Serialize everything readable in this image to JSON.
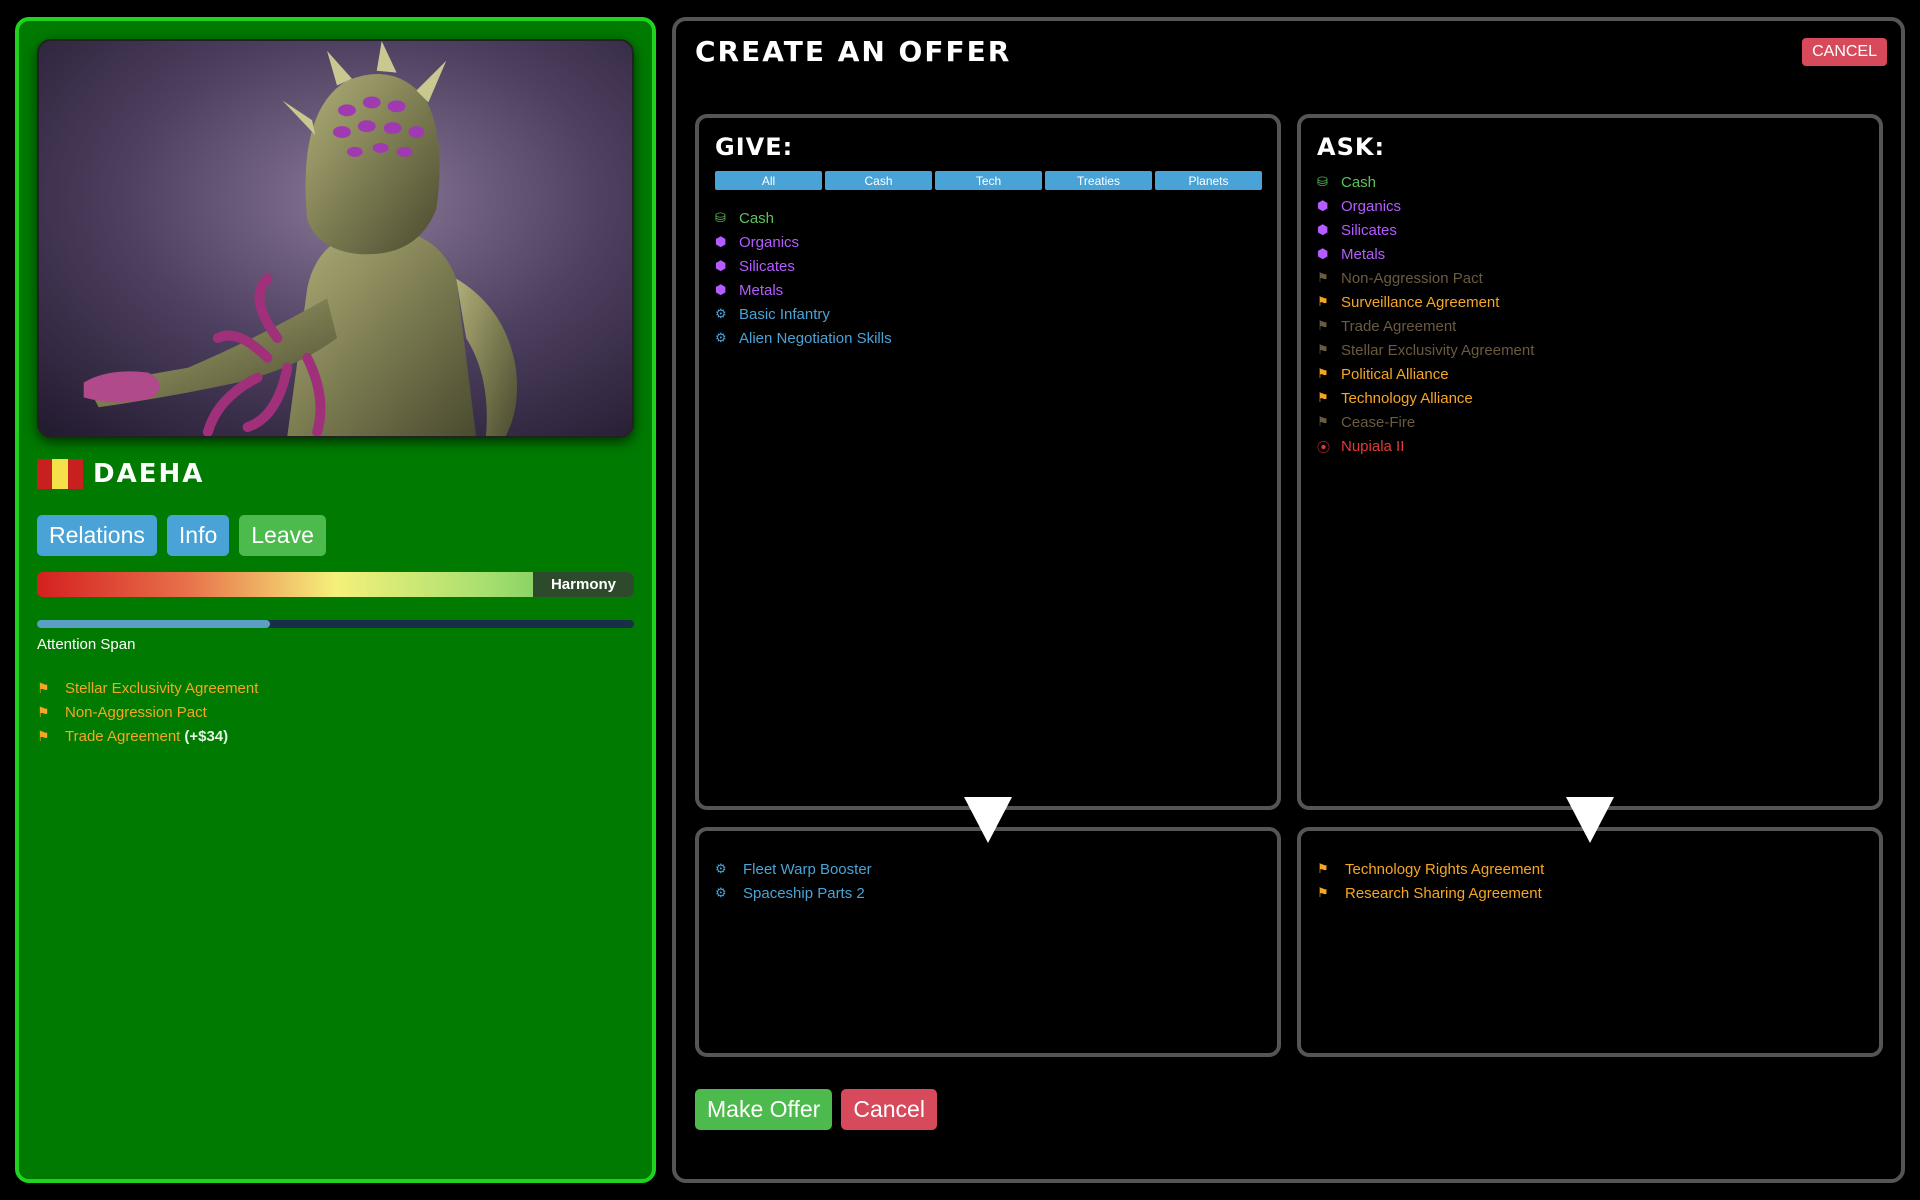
{
  "civ": {
    "name": "Daeha",
    "flag_colors": [
      "#c8201e",
      "#f5e04a",
      "#c8201e"
    ]
  },
  "left_buttons": {
    "relations": "Relations",
    "info": "Info",
    "leave": "Leave"
  },
  "relation": {
    "label": "Harmony"
  },
  "attention": {
    "label": "Attention Span",
    "level": 0.39
  },
  "treaties": [
    {
      "label": "Stellar Exclusivity Agreement",
      "extra": ""
    },
    {
      "label": "Non-Aggression Pact",
      "extra": ""
    },
    {
      "label": "Trade Agreement",
      "extra": "(+$34)"
    }
  ],
  "offer": {
    "title": "Create an Offer",
    "top_cancel": "CANCEL",
    "make_offer": "Make Offer",
    "cancel": "Cancel"
  },
  "give": {
    "title": "Give:",
    "filters": [
      "All",
      "Cash",
      "Tech",
      "Treaties",
      "Planets"
    ],
    "items": [
      {
        "label": "Cash",
        "kind": "cash"
      },
      {
        "label": "Organics",
        "kind": "resource"
      },
      {
        "label": "Silicates",
        "kind": "resource"
      },
      {
        "label": "Metals",
        "kind": "resource"
      },
      {
        "label": "Basic Infantry",
        "kind": "tech"
      },
      {
        "label": "Alien Negotiation Skills",
        "kind": "tech"
      }
    ],
    "selected": [
      {
        "label": "Fleet Warp Booster",
        "kind": "tech"
      },
      {
        "label": "Spaceship Parts 2",
        "kind": "tech"
      }
    ]
  },
  "ask": {
    "title": "Ask:",
    "items": [
      {
        "label": "Cash",
        "kind": "cash"
      },
      {
        "label": "Organics",
        "kind": "resource"
      },
      {
        "label": "Silicates",
        "kind": "resource"
      },
      {
        "label": "Metals",
        "kind": "resource"
      },
      {
        "label": "Non-Aggression Pact",
        "kind": "treaty-disabled"
      },
      {
        "label": "Surveillance Agreement",
        "kind": "treaty"
      },
      {
        "label": "Trade Agreement",
        "kind": "treaty-disabled"
      },
      {
        "label": "Stellar Exclusivity Agreement",
        "kind": "treaty-disabled"
      },
      {
        "label": "Political Alliance",
        "kind": "treaty"
      },
      {
        "label": "Technology Alliance",
        "kind": "treaty"
      },
      {
        "label": "Cease-Fire",
        "kind": "treaty-disabled"
      },
      {
        "label": "Nupiala II",
        "kind": "planet"
      }
    ],
    "selected": [
      {
        "label": "Technology Rights Agreement",
        "kind": "treaty"
      },
      {
        "label": "Research Sharing Agreement",
        "kind": "treaty"
      }
    ]
  },
  "icons": {
    "cash": "coins-icon",
    "resource": "hexagon-icon",
    "tech": "gear-icon",
    "treaty": "flag-icon",
    "treaty-disabled": "flag-icon",
    "planet": "planet-icon"
  }
}
